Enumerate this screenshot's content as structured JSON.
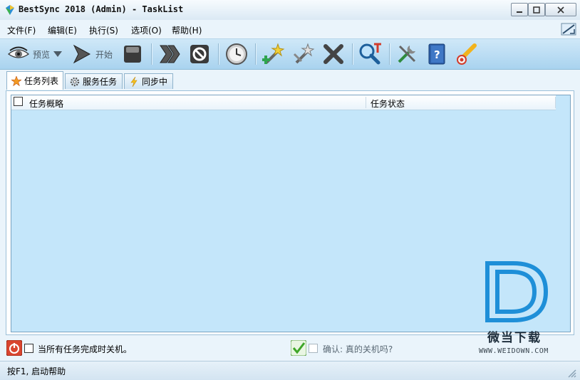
{
  "window": {
    "title": "BestSync 2018 (Admin) - TaskList"
  },
  "menu": [
    {
      "label": "文件(F)"
    },
    {
      "label": "编辑(E)"
    },
    {
      "label": "执行(S)"
    },
    {
      "label": "选项(O)"
    },
    {
      "label": "帮助(H)"
    }
  ],
  "toolbar": {
    "preview_label": "预览",
    "start_label": "开始",
    "icons": [
      "eye-icon",
      "play-icon",
      "stop-icon",
      "fast-forward-icon",
      "cancel-icon",
      "clock-icon",
      "new-task-icon",
      "edit-task-icon",
      "delete-icon",
      "search-icon",
      "tools-icon",
      "help-book-icon",
      "about-icon"
    ]
  },
  "tabs": [
    {
      "label": "任务列表",
      "active": true
    },
    {
      "label": "服务任务",
      "active": false
    },
    {
      "label": "同步中",
      "active": false
    }
  ],
  "list": {
    "columns": [
      "任务概略",
      "任务状态"
    ],
    "rows": []
  },
  "bottom": {
    "shutdown_label": "当所有任务完成时关机。",
    "shutdown_checked": false,
    "confirm_label": "确认: 真的关机吗?",
    "confirm_checked": false
  },
  "status": {
    "text": "按F1, 启动帮助"
  },
  "watermark": {
    "cn": "微当下载",
    "url": "WWW.WEIDOWN.COM"
  },
  "colors": {
    "toolbar_bg": "#a9d3ef",
    "list_bg": "#c4e6fa",
    "accent_blue": "#1e8fd8"
  }
}
